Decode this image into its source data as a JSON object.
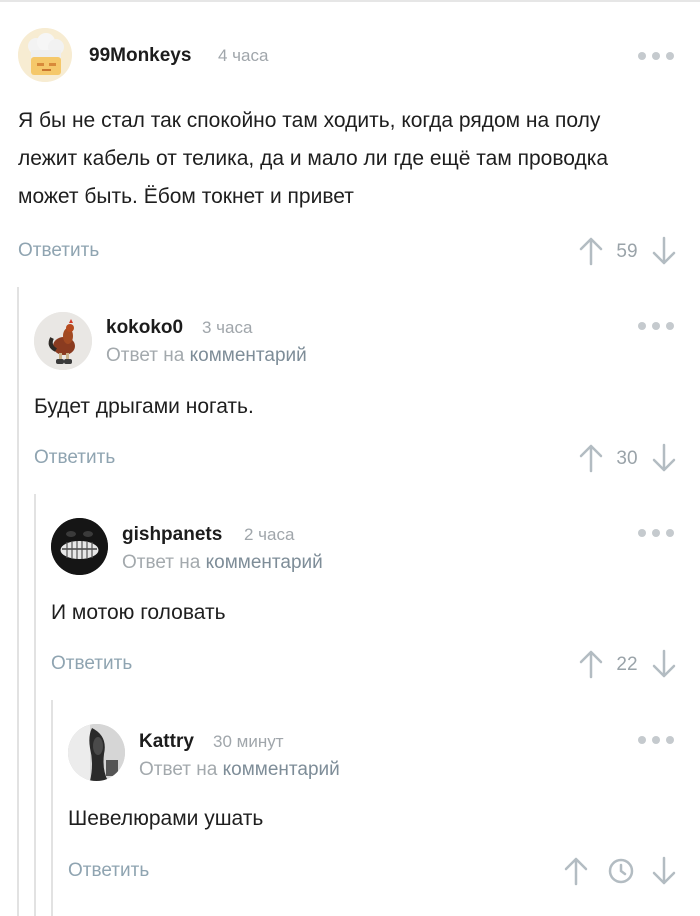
{
  "comments": [
    {
      "author": "99Monkeys",
      "time": "4 часа",
      "text": "Я бы не стал так спокойно там ходить, когда рядом на полу лежит кабель от телика, да и мало ли где ещё там проводка может быть. Ёбом токнет и привет",
      "reply_label": "Ответить",
      "score": "59",
      "avatar": "chef-hat-avatar"
    },
    {
      "author": "kokoko0",
      "time": "3 часа",
      "reply_prefix": "Ответ на",
      "reply_link": "комментарий",
      "text": "Будет дрыгами ногать.",
      "reply_label": "Ответить",
      "score": "30",
      "avatar": "rooster-avatar"
    },
    {
      "author": "gishpanets",
      "time": "2 часа",
      "reply_prefix": "Ответ на",
      "reply_link": "комментарий",
      "text": "И мотою головать",
      "reply_label": "Ответить",
      "score": "22",
      "avatar": "grin-face-avatar"
    },
    {
      "author": "Kattry",
      "time": "30 минут",
      "reply_prefix": "Ответ на",
      "reply_link": "комментарий",
      "text": "Шевелюрами ушать",
      "reply_label": "Ответить",
      "score_icon": "clock-icon",
      "avatar": "photo-avatar"
    }
  ],
  "colors": {
    "link": "#8fa4b1",
    "muted": "#a0a6ab",
    "arrow": "#b3bcc2",
    "thread_line": "#e2e2e2"
  }
}
